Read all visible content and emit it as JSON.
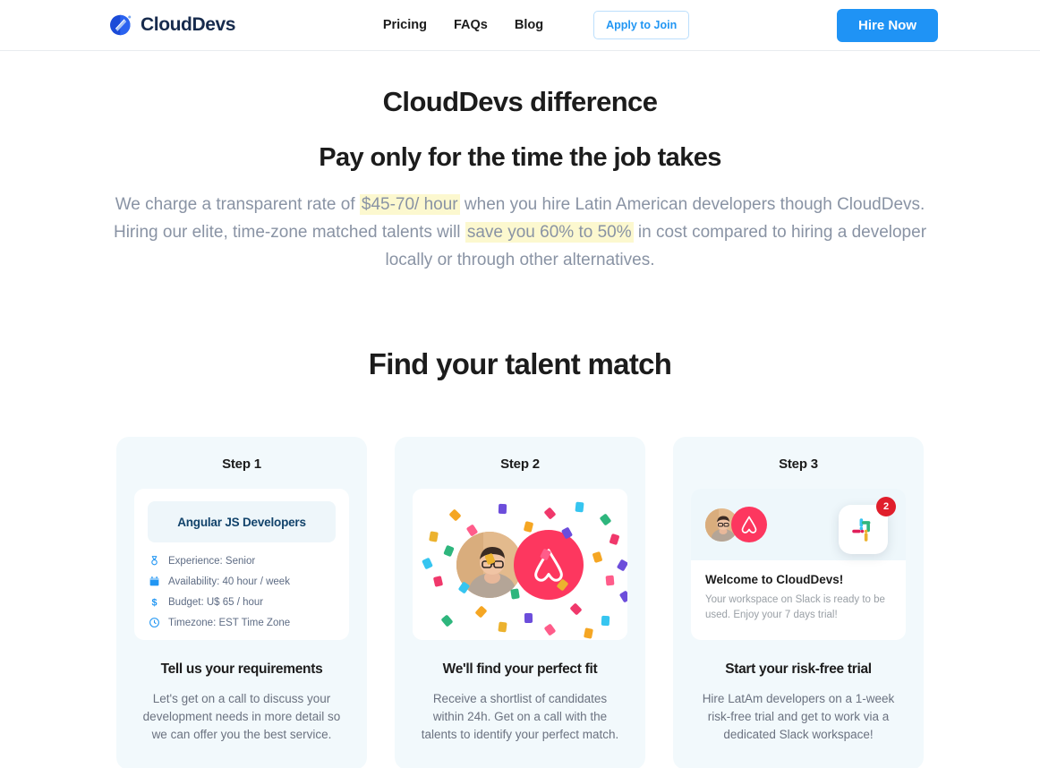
{
  "header": {
    "logo_text": "CloudDevs",
    "logo_icon": "clouddevs-diamond-logo",
    "nav": [
      {
        "label": "Pricing"
      },
      {
        "label": "FAQs"
      },
      {
        "label": "Blog"
      }
    ],
    "apply_label": "Apply to Join",
    "hire_label": "Hire Now",
    "accent_blue": "#1f93f5",
    "apply_border": "#bcdffc"
  },
  "intro": {
    "eyebrow": "CloudDevs difference",
    "title": "Pay only for the time the job takes",
    "paragraph": {
      "p1": "We charge a transparent rate of ",
      "hl1": "$45-70/ hour",
      "p2": " when you hire Latin American developers though CloudDevs. Hiring our elite, time-zone matched talents will ",
      "hl2": "save you 60% to 50%",
      "p3": " in cost compared to hiring a developer locally or through other alternatives."
    },
    "highlight_color": "#fcf8cf"
  },
  "section": {
    "title": "Find your talent match"
  },
  "cards": [
    {
      "step_label": "Step 1",
      "heading": "Tell us your requirements",
      "body": "Let's get on a call to discuss your development needs in more detail so we can offer you the best service.",
      "pill_label": "Angular JS Developers",
      "requirements": [
        {
          "icon": "medal-icon",
          "text": "Experience: Senior"
        },
        {
          "icon": "calendar-icon",
          "text": "Availability: 40 hour / week"
        },
        {
          "icon": "dollar-icon",
          "text": "Budget: U$ 65 / hour"
        },
        {
          "icon": "clock-icon",
          "text": "Timezone: EST Time Zone"
        }
      ]
    },
    {
      "step_label": "Step 2",
      "heading": "We'll find your perfect fit",
      "body": "Receive a shortlist of candidates within 24h. Get on a call with the talents to identify your perfect match.",
      "media": {
        "avatar": "developer-avatar",
        "brand_logo": "airbnb-logo",
        "brand_color": "#fd375f",
        "background": "confetti"
      }
    },
    {
      "step_label": "Step 3",
      "heading": "Start your risk-free trial",
      "body": "Hire LatAm developers on a 1-week risk-free trial and get to work via a dedicated Slack workspace!",
      "notification": {
        "title": "Welcome to CloudDevs!",
        "text": "Your workspace on Slack is ready to be used. Enjoy your 7 days trial!",
        "app_icon": "slack-icon",
        "badge_count": "2",
        "badge_color": "#e01e2b"
      }
    }
  ]
}
